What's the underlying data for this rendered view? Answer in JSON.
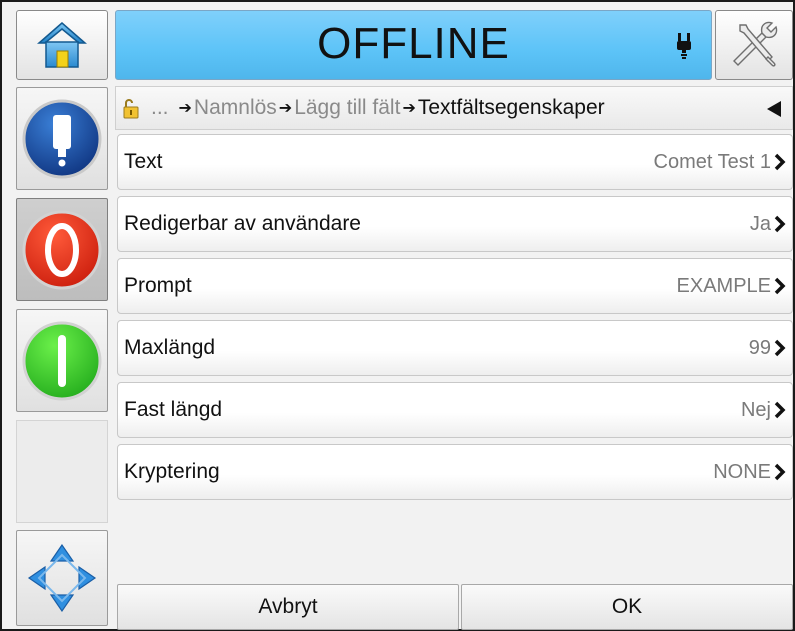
{
  "header": {
    "status": "OFFLINE",
    "status_color": "#5cc3f7"
  },
  "nav": {
    "home_icon": "home-icon",
    "tools_icon": "tools-icon",
    "connection_icon": "plug-icon"
  },
  "sidebar": {
    "items": [
      {
        "name": "ink-status-button",
        "icon": "ink-cartridge-icon"
      },
      {
        "name": "stop-button",
        "icon": "stop-icon"
      },
      {
        "name": "start-button",
        "icon": "start-icon"
      },
      {
        "name": "navigate-button",
        "icon": "direction-pad-icon"
      }
    ]
  },
  "breadcrumb": {
    "ellipsis": "...",
    "items": [
      "Namnlös",
      "Lägg till fält",
      "Textfältsegenskaper"
    ],
    "lock_icon": "padlock-open-icon",
    "back_icon": "triangle-left-icon"
  },
  "properties": [
    {
      "label": "Text",
      "value": "Comet Test 1"
    },
    {
      "label": "Redigerbar av användare",
      "value": "Ja"
    },
    {
      "label": "Prompt",
      "value": "EXAMPLE"
    },
    {
      "label": "Maxlängd",
      "value": "99"
    },
    {
      "label": "Fast längd",
      "value": "Nej"
    },
    {
      "label": "Kryptering",
      "value": "NONE"
    }
  ],
  "footer": {
    "cancel_label": "Avbryt",
    "ok_label": "OK"
  }
}
